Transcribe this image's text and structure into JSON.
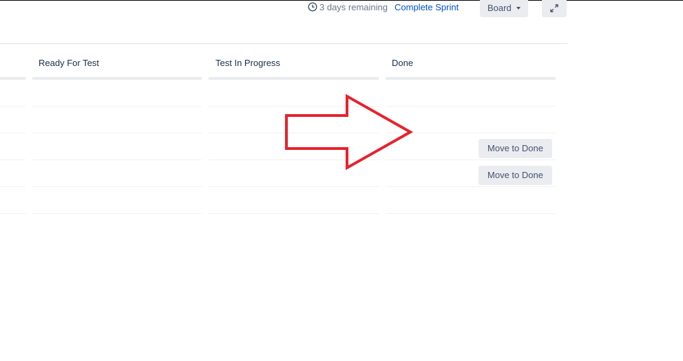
{
  "header": {
    "remaining_text": "3 days remaining",
    "complete_sprint_label": "Complete Sprint",
    "board_button_label": "Board"
  },
  "columns": [
    {
      "title": ""
    },
    {
      "title": "Ready For Test"
    },
    {
      "title": "Test In Progress"
    },
    {
      "title": "Done"
    }
  ],
  "actions": {
    "move_to_done_1": "Move to Done",
    "move_to_done_2": "Move to Done"
  },
  "colors": {
    "accent_link": "#0052cc",
    "annotation_arrow": "#e8212b",
    "button_bg": "#ebecf0"
  },
  "icons": [
    "clock-icon",
    "chevron-down-icon",
    "expand-icon",
    "annotation-arrow"
  ]
}
